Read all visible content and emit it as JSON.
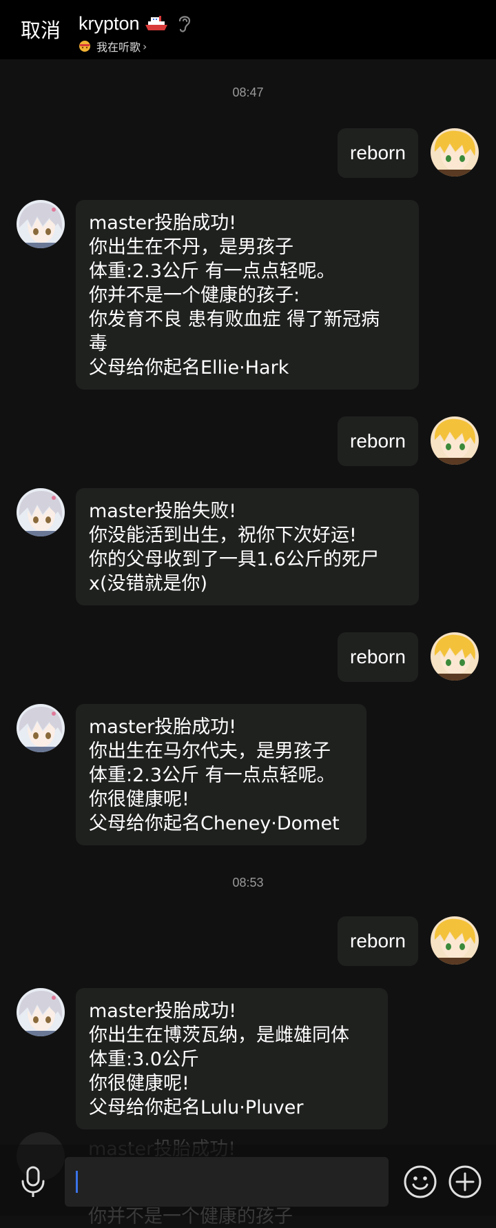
{
  "header": {
    "cancel_label": "取消",
    "contact_name": "krypton",
    "status_text": "我在听歌",
    "status_chevron": "›",
    "icons": [
      "ship-icon",
      "ear-icon",
      "music-icon"
    ]
  },
  "chat": {
    "timestamps": [
      "08:47",
      "08:53"
    ],
    "outgoing": [
      {
        "text": "reborn"
      },
      {
        "text": "reborn"
      },
      {
        "text": "reborn"
      },
      {
        "text": "reborn"
      }
    ],
    "incoming": [
      {
        "lines": [
          "master投胎成功!",
          "你出生在不丹，是男孩子",
          "体重:2.3公斤 有一点点轻呢。",
          "你并不是一个健康的孩子:",
          "你发育不良 患有败血症 得了新冠病",
          "毒",
          "父母给你起名Ellie·Hark"
        ]
      },
      {
        "lines": [
          "master投胎失败!",
          "你没能活到出生，祝你下次好运!",
          "你的父母收到了一具1.6公斤的死尸",
          "x(没错就是你)"
        ]
      },
      {
        "lines": [
          "master投胎成功!",
          "你出生在马尔代夫，是男孩子",
          "体重:2.3公斤 有一点点轻呢。",
          "你很健康呢!",
          "父母给你起名Cheney·Domet"
        ]
      },
      {
        "lines": [
          "master投胎成功!",
          "你出生在博茨瓦纳，是雌雄同体",
          "体重:3.0公斤",
          "你很健康呢!",
          "父母给你起名Lulu·Pluver"
        ]
      }
    ],
    "faded_lines": [
      "master投胎成功!",
      "你并不是一个健康的孩子"
    ]
  },
  "input": {
    "value": "",
    "icons": [
      "microphone-icon",
      "emoji-icon",
      "plus-icon"
    ]
  },
  "colors": {
    "background": "#111111",
    "header": "#000000",
    "bubble": "#1f211f",
    "caret": "#3b73e8",
    "timestamp": "#9a9a9a"
  }
}
